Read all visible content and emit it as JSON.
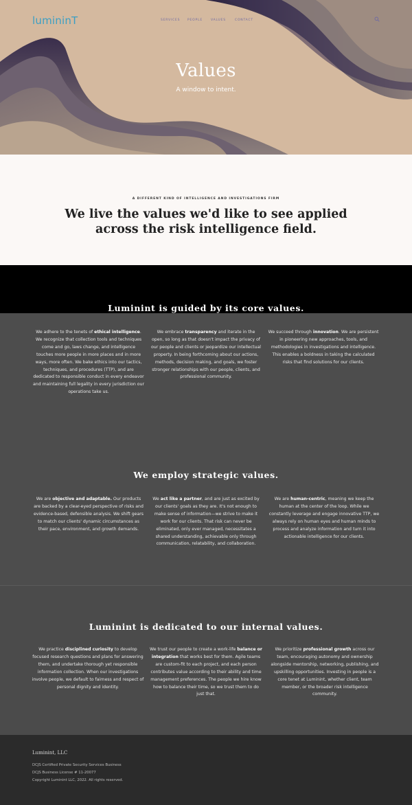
{
  "header": {
    "logo": "lumininT",
    "nav": [
      "SERVICES",
      "PEOPLE",
      "VALUES",
      "CONTACT"
    ]
  },
  "hero": {
    "title": "Values",
    "subtitle": "A window to intent."
  },
  "intro": {
    "eyebrow": "A DIFFERENT KIND OF INTELLIGENCE AND INVESTIGATIONS FIRM",
    "heading": "We live the values we'd like to see applied across the risk intelligence field."
  },
  "core": {
    "heading_pre": "Luminint is guided by its ",
    "heading_bold": "core values",
    "heading_post": ".",
    "cols": [
      {
        "pre": "We adhere to the tenets of ",
        "bold": "ethical intelligence",
        "post": ". We recognize that collection tools and techniques come and go, laws change, and intelligence touches more people in more places and in more ways, more often. We bake ethics into our tactics, techniques, and procedures (TTP), and are dedicated to responsible conduct in every endeavor and maintaining full legality in every jurisdiction our operations take us."
      },
      {
        "pre": "We embrace ",
        "bold": "transparency",
        "post": " and iterate in the open, so long as that doesn't impact the privacy of our people and clients or jeopardize our intellectual property. In being forthcoming about our actions, methods, decision making, and goals, we foster stronger relationships with our people, clients, and professional community."
      },
      {
        "pre": "We succeed through ",
        "bold": "innovation",
        "post": ". We are persistent in pioneering new approaches, tools, and methodologies in investigations and intelligence. This enables a boldness in taking the calculated risks that find solutions for our clients."
      }
    ]
  },
  "strategic": {
    "heading_pre": "We employ ",
    "heading_bold": "strategic values",
    "heading_post": ".",
    "cols": [
      {
        "pre": "We are ",
        "bold": "objective and adaptable.",
        "post": " Our products are backed by a clear-eyed perspective of risks and evidence-based, defensible analysis. We shift gears to match our clients' dynamic circumstances as their pace, environment, and growth demands."
      },
      {
        "pre": "We ",
        "bold": "act like a partner",
        "post": ", and are just as excited by our clients' goals as they are. It's not enough to make sense of information—we strive to make it work for our clients. That risk can never be eliminated, only ever managed, necessitates a shared understanding, achievable only through communication, relatability, and collaboration."
      },
      {
        "pre": "We are ",
        "bold": "human-centric",
        "post": ", meaning we keep the human at the center of the loop. While we constantly leverage and engage innovative TTP, we always rely on human eyes and human minds to process and analyze information and turn it into actionable intelligence for our clients."
      }
    ]
  },
  "internal": {
    "heading_pre": "Luminint is dedicated to our ",
    "heading_bold": "internal values",
    "heading_post": ".",
    "cols": [
      {
        "pre": "We practice ",
        "bold": "disciplined curiosity",
        "post": " to develop focused research questions and plans for answering them, and undertake thorough yet responsible information collection. When our investigations involve people, we default to fairness and respect of personal dignity and identity."
      },
      {
        "pre": "We trust our people to create a work-life ",
        "bold": "balance or integration",
        "post": " that works best for them. Agile teams are custom-fit to each project, and each person contributes value according to their ability and time management preferences. The people we hire know how to balance their time, so we trust them to do just that."
      },
      {
        "pre": "We prioritize ",
        "bold": "professional growth",
        "post": " across our team, encouraging autonomy and ownership alongside mentorship, networking, publishing, and upskilling opportunities. Investing in people is a core tenet at Luminint, whether client, team member, or the broader risk intelligence community."
      }
    ]
  },
  "footer": {
    "brand": "Luminint, LLC",
    "lines": [
      "DCJS Certified Private Security Services Business",
      "DCJS Business License # 11-20077",
      "Copyright Luminint LLC, 2022.  All rights reserved."
    ]
  },
  "icons": {
    "search": "search-icon"
  }
}
